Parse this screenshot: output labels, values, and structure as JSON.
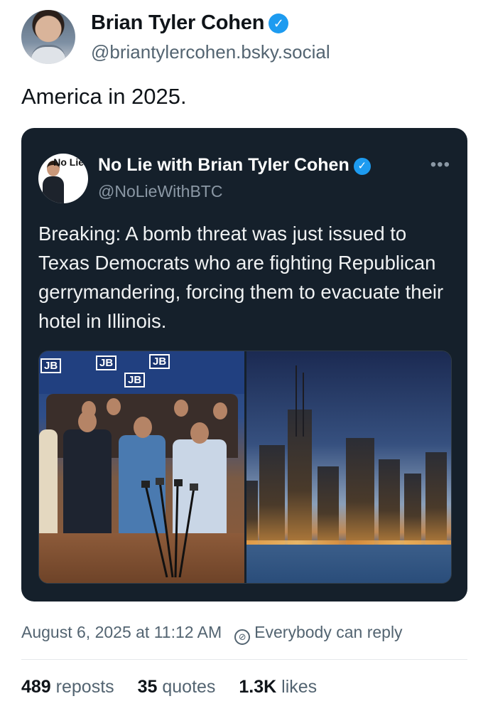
{
  "post": {
    "author_name": "Brian Tyler Cohen",
    "handle": "@briantylercohen.bsky.social",
    "text": "America in 2025.",
    "verified_icon": "verified-badge-icon",
    "accent": "#1d9bf0"
  },
  "quoted_post": {
    "author_name": "No Lie with Brian Tyler Cohen",
    "handle": "@NoLieWithBTC",
    "avatar_logo": "No Lie",
    "more_label": "•••",
    "text": "Breaking: A bomb threat was just issued to Texas Democrats who are fighting Republican gerrymandering, forcing them to evacuate their hotel in Illinois.",
    "card_bg": "#15202b",
    "images": {
      "left_banner_text": "JB",
      "right_description_icon": "city-skyline-icon"
    }
  },
  "meta": {
    "timestamp": "August 6, 2025 at 11:12 AM",
    "reply_setting": "Everybody can reply"
  },
  "stats": {
    "reposts_count": "489",
    "reposts_label": "reposts",
    "quotes_count": "35",
    "quotes_label": "quotes",
    "likes_count": "1.3K",
    "likes_label": "likes"
  }
}
